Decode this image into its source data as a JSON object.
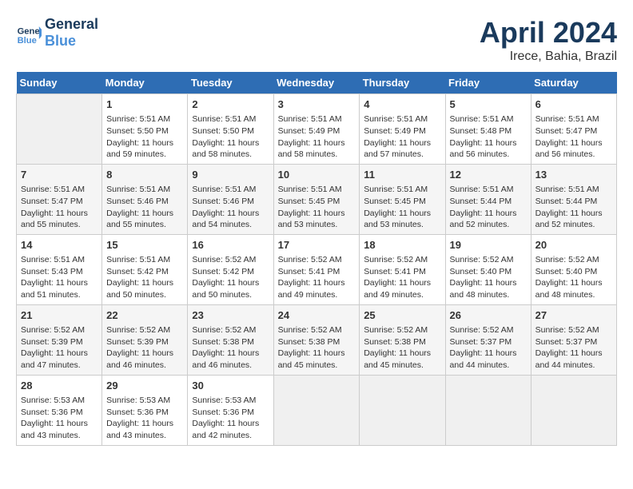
{
  "header": {
    "logo_line1": "General",
    "logo_line2": "Blue",
    "month": "April 2024",
    "location": "Irece, Bahia, Brazil"
  },
  "days_of_week": [
    "Sunday",
    "Monday",
    "Tuesday",
    "Wednesday",
    "Thursday",
    "Friday",
    "Saturday"
  ],
  "weeks": [
    [
      {
        "num": "",
        "empty": true
      },
      {
        "num": "1",
        "sunrise": "5:51 AM",
        "sunset": "5:50 PM",
        "daylight": "11 hours and 59 minutes."
      },
      {
        "num": "2",
        "sunrise": "5:51 AM",
        "sunset": "5:50 PM",
        "daylight": "11 hours and 58 minutes."
      },
      {
        "num": "3",
        "sunrise": "5:51 AM",
        "sunset": "5:49 PM",
        "daylight": "11 hours and 58 minutes."
      },
      {
        "num": "4",
        "sunrise": "5:51 AM",
        "sunset": "5:49 PM",
        "daylight": "11 hours and 57 minutes."
      },
      {
        "num": "5",
        "sunrise": "5:51 AM",
        "sunset": "5:48 PM",
        "daylight": "11 hours and 56 minutes."
      },
      {
        "num": "6",
        "sunrise": "5:51 AM",
        "sunset": "5:47 PM",
        "daylight": "11 hours and 56 minutes."
      }
    ],
    [
      {
        "num": "7",
        "sunrise": "5:51 AM",
        "sunset": "5:47 PM",
        "daylight": "11 hours and 55 minutes."
      },
      {
        "num": "8",
        "sunrise": "5:51 AM",
        "sunset": "5:46 PM",
        "daylight": "11 hours and 55 minutes."
      },
      {
        "num": "9",
        "sunrise": "5:51 AM",
        "sunset": "5:46 PM",
        "daylight": "11 hours and 54 minutes."
      },
      {
        "num": "10",
        "sunrise": "5:51 AM",
        "sunset": "5:45 PM",
        "daylight": "11 hours and 53 minutes."
      },
      {
        "num": "11",
        "sunrise": "5:51 AM",
        "sunset": "5:45 PM",
        "daylight": "11 hours and 53 minutes."
      },
      {
        "num": "12",
        "sunrise": "5:51 AM",
        "sunset": "5:44 PM",
        "daylight": "11 hours and 52 minutes."
      },
      {
        "num": "13",
        "sunrise": "5:51 AM",
        "sunset": "5:44 PM",
        "daylight": "11 hours and 52 minutes."
      }
    ],
    [
      {
        "num": "14",
        "sunrise": "5:51 AM",
        "sunset": "5:43 PM",
        "daylight": "11 hours and 51 minutes."
      },
      {
        "num": "15",
        "sunrise": "5:51 AM",
        "sunset": "5:42 PM",
        "daylight": "11 hours and 50 minutes."
      },
      {
        "num": "16",
        "sunrise": "5:52 AM",
        "sunset": "5:42 PM",
        "daylight": "11 hours and 50 minutes."
      },
      {
        "num": "17",
        "sunrise": "5:52 AM",
        "sunset": "5:41 PM",
        "daylight": "11 hours and 49 minutes."
      },
      {
        "num": "18",
        "sunrise": "5:52 AM",
        "sunset": "5:41 PM",
        "daylight": "11 hours and 49 minutes."
      },
      {
        "num": "19",
        "sunrise": "5:52 AM",
        "sunset": "5:40 PM",
        "daylight": "11 hours and 48 minutes."
      },
      {
        "num": "20",
        "sunrise": "5:52 AM",
        "sunset": "5:40 PM",
        "daylight": "11 hours and 48 minutes."
      }
    ],
    [
      {
        "num": "21",
        "sunrise": "5:52 AM",
        "sunset": "5:39 PM",
        "daylight": "11 hours and 47 minutes."
      },
      {
        "num": "22",
        "sunrise": "5:52 AM",
        "sunset": "5:39 PM",
        "daylight": "11 hours and 46 minutes."
      },
      {
        "num": "23",
        "sunrise": "5:52 AM",
        "sunset": "5:38 PM",
        "daylight": "11 hours and 46 minutes."
      },
      {
        "num": "24",
        "sunrise": "5:52 AM",
        "sunset": "5:38 PM",
        "daylight": "11 hours and 45 minutes."
      },
      {
        "num": "25",
        "sunrise": "5:52 AM",
        "sunset": "5:38 PM",
        "daylight": "11 hours and 45 minutes."
      },
      {
        "num": "26",
        "sunrise": "5:52 AM",
        "sunset": "5:37 PM",
        "daylight": "11 hours and 44 minutes."
      },
      {
        "num": "27",
        "sunrise": "5:52 AM",
        "sunset": "5:37 PM",
        "daylight": "11 hours and 44 minutes."
      }
    ],
    [
      {
        "num": "28",
        "sunrise": "5:53 AM",
        "sunset": "5:36 PM",
        "daylight": "11 hours and 43 minutes."
      },
      {
        "num": "29",
        "sunrise": "5:53 AM",
        "sunset": "5:36 PM",
        "daylight": "11 hours and 43 minutes."
      },
      {
        "num": "30",
        "sunrise": "5:53 AM",
        "sunset": "5:36 PM",
        "daylight": "11 hours and 42 minutes."
      },
      {
        "num": "",
        "empty": true
      },
      {
        "num": "",
        "empty": true
      },
      {
        "num": "",
        "empty": true
      },
      {
        "num": "",
        "empty": true
      }
    ]
  ],
  "labels": {
    "sunrise": "Sunrise:",
    "sunset": "Sunset:",
    "daylight": "Daylight:"
  }
}
